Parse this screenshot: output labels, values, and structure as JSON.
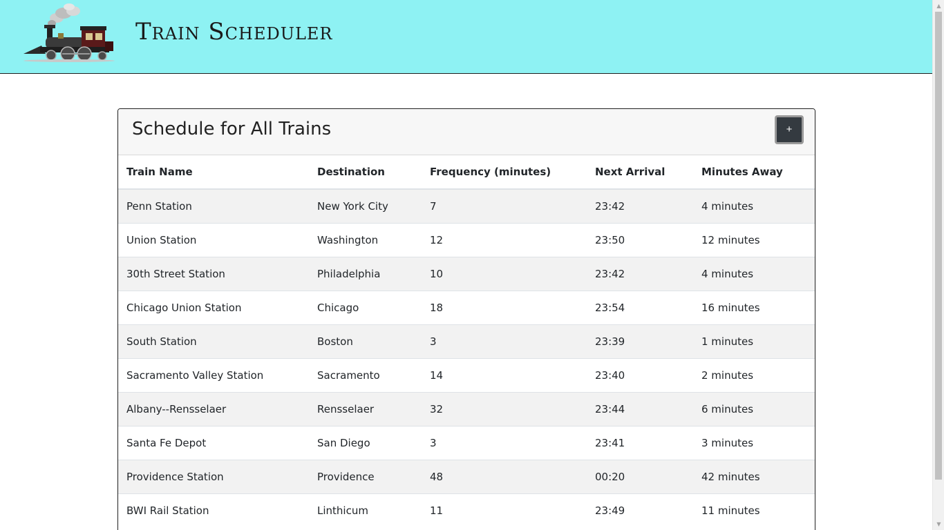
{
  "header": {
    "title": "Train Scheduler",
    "logo_icon": "steam-locomotive-icon"
  },
  "schedule": {
    "title": "Schedule for All Trains",
    "add_label": "+",
    "columns": [
      "Train Name",
      "Destination",
      "Frequency (minutes)",
      "Next Arrival",
      "Minutes Away"
    ],
    "rows": [
      {
        "name": "Penn Station",
        "destination": "New York City",
        "frequency": "7",
        "next": "23:42",
        "away": "4 minutes"
      },
      {
        "name": "Union Station",
        "destination": "Washington",
        "frequency": "12",
        "next": "23:50",
        "away": "12 minutes"
      },
      {
        "name": "30th Street Station",
        "destination": "Philadelphia",
        "frequency": "10",
        "next": "23:42",
        "away": "4 minutes"
      },
      {
        "name": "Chicago Union Station",
        "destination": "Chicago",
        "frequency": "18",
        "next": "23:54",
        "away": "16 minutes"
      },
      {
        "name": "South Station",
        "destination": "Boston",
        "frequency": "3",
        "next": "23:39",
        "away": "1 minutes"
      },
      {
        "name": "Sacramento Valley Station",
        "destination": "Sacramento",
        "frequency": "14",
        "next": "23:40",
        "away": "2 minutes"
      },
      {
        "name": "Albany--Rensselaer",
        "destination": "Rensselaer",
        "frequency": "32",
        "next": "23:44",
        "away": "6 minutes"
      },
      {
        "name": "Santa Fe Depot",
        "destination": "San Diego",
        "frequency": "3",
        "next": "23:41",
        "away": "3 minutes"
      },
      {
        "name": "Providence Station",
        "destination": "Providence",
        "frequency": "48",
        "next": "00:20",
        "away": "42 minutes"
      },
      {
        "name": "BWI Rail Station",
        "destination": "Linthicum",
        "frequency": "11",
        "next": "23:49",
        "away": "11 minutes"
      }
    ]
  },
  "colors": {
    "header_bg": "#8ef2f3",
    "button_bg": "#343a40",
    "stripe": "#f2f2f2"
  }
}
